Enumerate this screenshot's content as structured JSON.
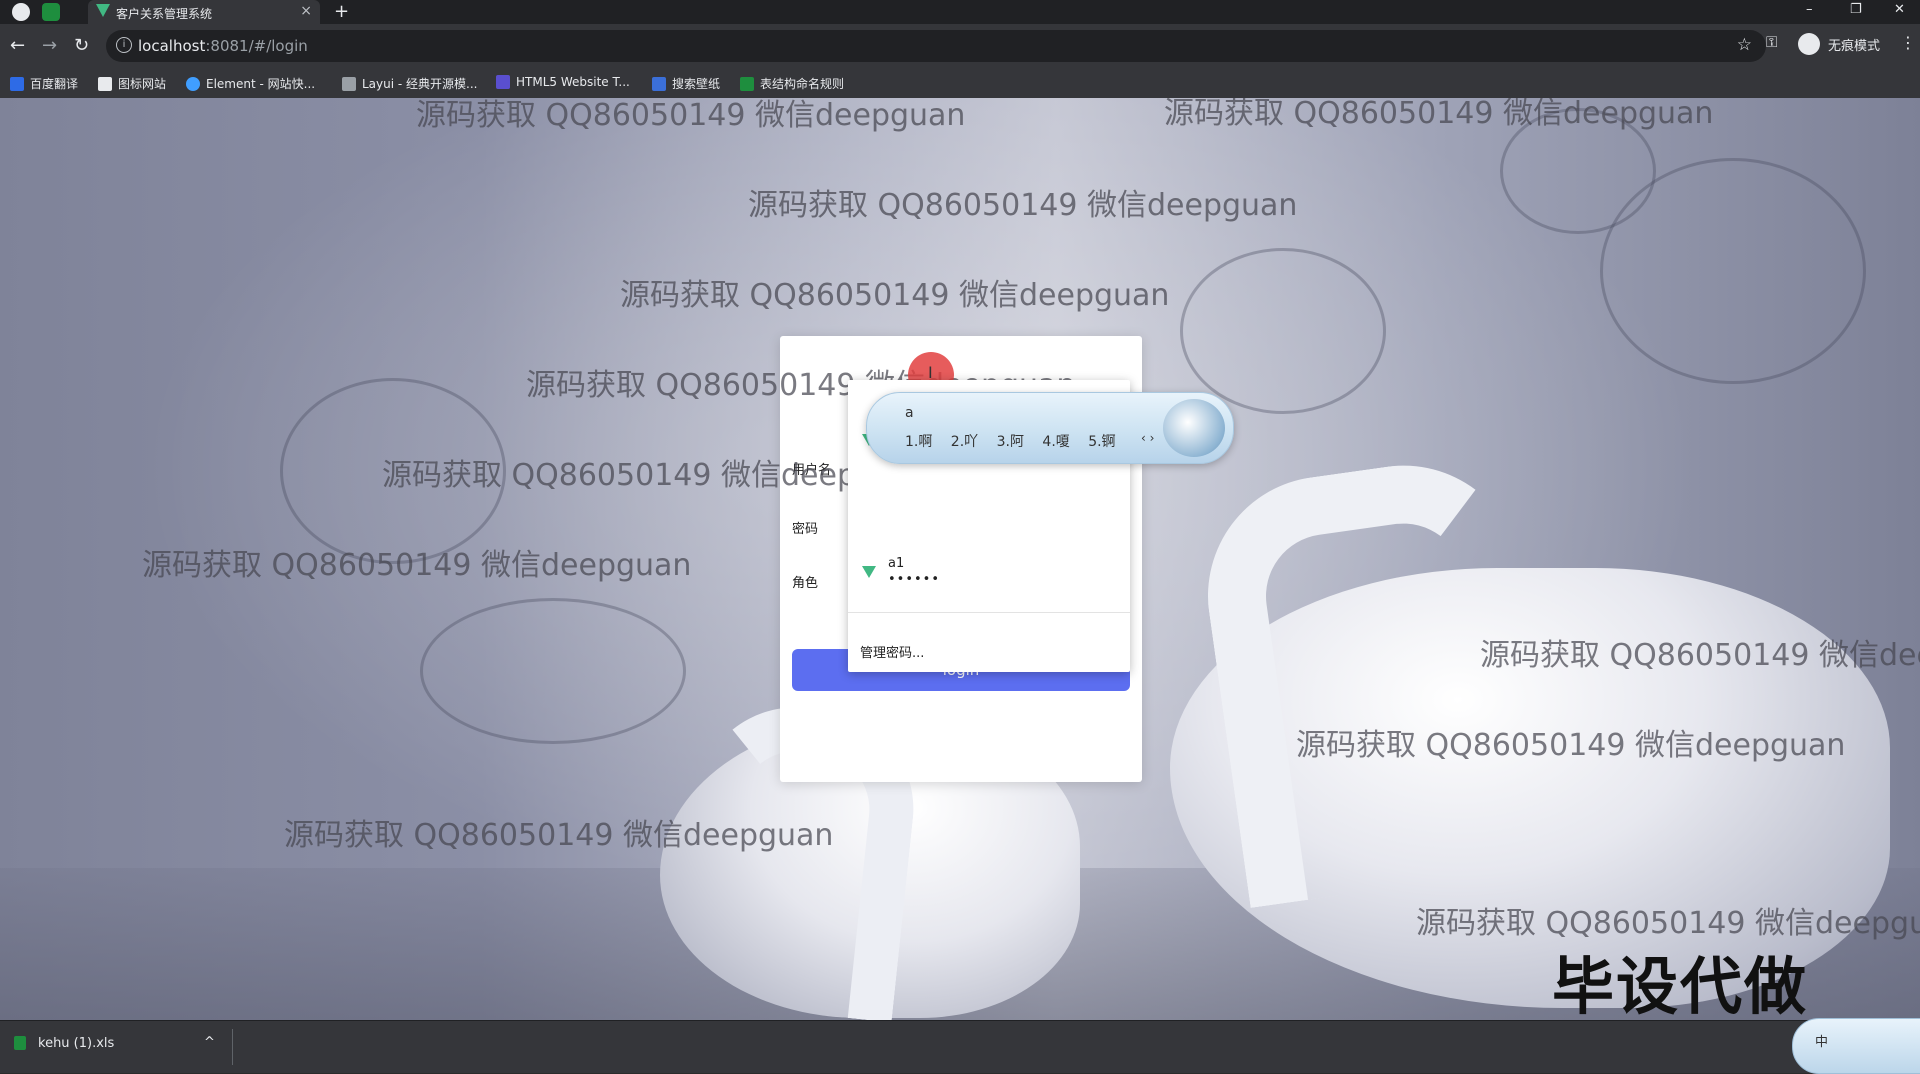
{
  "browser": {
    "tab_title": "客户关系管理系统",
    "tab_close": "×",
    "new_tab": "+",
    "url_host": "localhost",
    "url_rest": ":8081/#/login",
    "star": "☆",
    "key_icon": "⚿",
    "incognito_label": "无痕模式",
    "menu": "⋮",
    "win_min": "–",
    "win_restore": "❐",
    "win_close": "✕",
    "back": "←",
    "forward": "→",
    "reload": "↻"
  },
  "bookmarks": [
    {
      "label": "百度翻译",
      "color": "#2e6be6"
    },
    {
      "label": "图标网站",
      "color": "#e8eaed"
    },
    {
      "label": "Element - 网站快...",
      "color": "#409eff"
    },
    {
      "label": "Layui - 经典开源模...",
      "color": "#9aa0a6"
    },
    {
      "label": "HTML5 Website T...",
      "color": "#5a4fcf"
    },
    {
      "label": "搜索壁纸",
      "color": "#3b6fd8"
    },
    {
      "label": "表结构命名规则",
      "color": "#1e8e3e"
    }
  ],
  "watermarks": [
    "源码获取 QQ86050149 微信deepguan",
    "源码获取 QQ86050149 微信deepguan",
    "源码获取 QQ86050149 微信deepguan",
    "源码获取 QQ86050149 微信deepguan",
    "源码获取 QQ86050149 微信deepguan",
    "源码获取 QQ86050149 微信deepguan",
    "源码获取 QQ86050149 微信deepguan",
    "源码获取 QQ86050149 微信dee",
    "源码获取 QQ86050149 微信deepguan",
    "源码获取 QQ86050149 微信deepguan",
    "源码获取 QQ86050149 微信deepgua"
  ],
  "corner_text": "毕设代做",
  "login": {
    "title": "客户关系管理系统",
    "username_label": "用户名",
    "username_value": "a",
    "password_label": "密码",
    "role_label": "角色",
    "button": "login"
  },
  "autofill": {
    "entries": [
      {
        "user": "a1",
        "password": "••••••"
      }
    ],
    "manage": "管理密码..."
  },
  "ime": {
    "composition": "a",
    "candidates": "1.啊 2.吖 3.阿 4.嗄 5.锕",
    "arrows": "‹ ›",
    "tray_label": "中"
  },
  "downloads": {
    "file": "kehu (1).xls",
    "chevron": "^"
  },
  "colors": {
    "accent": "#5c6ef0",
    "title": "#5b6fe3",
    "vue": "#41b883"
  }
}
